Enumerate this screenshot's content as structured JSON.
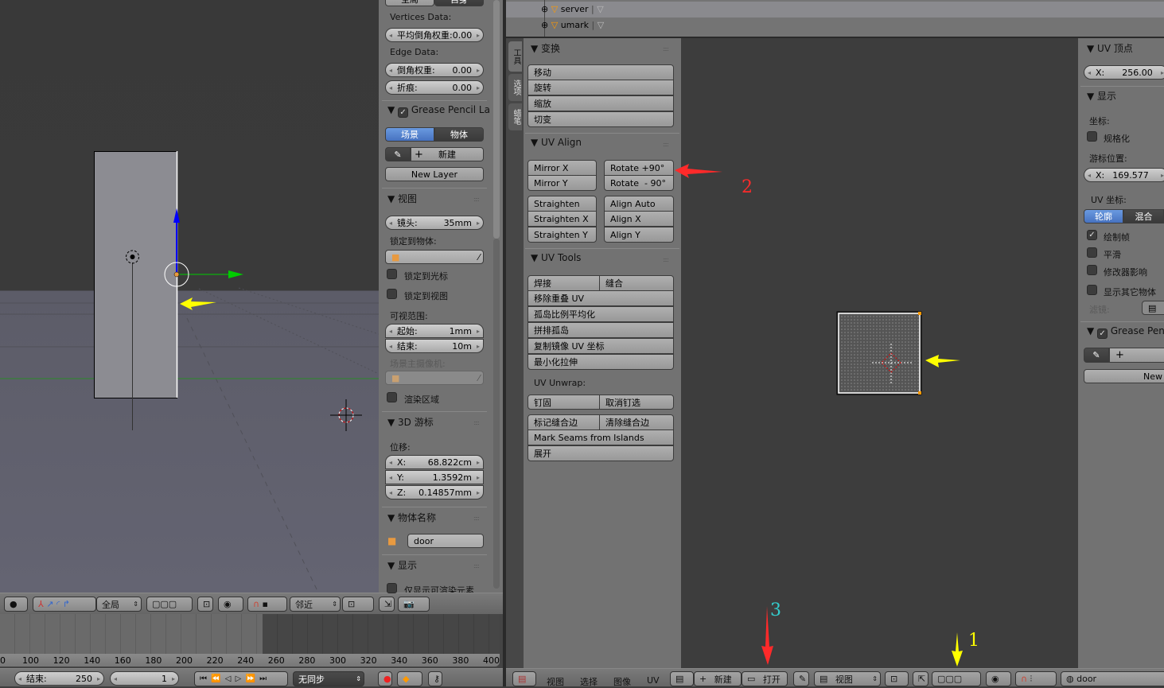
{
  "viewport3d": {
    "header": {
      "orientation_dropdown": "全局",
      "pivot_dropdown": "邻近"
    }
  },
  "properties": {
    "top_buttons": [
      "全局",
      "自身"
    ],
    "vertices_label": "Vertices Data:",
    "mean_bevel": "平均倒角权重:0.00",
    "edge_label": "Edge Data:",
    "bevel_weight": {
      "label": "倒角权重:",
      "value": "0.00"
    },
    "crease": {
      "label": "折痕:",
      "value": "0.00"
    },
    "grease_pencil": {
      "title": "Grease Pencil La",
      "checked": true,
      "tabs": [
        "场景",
        "物体"
      ],
      "new": "新建",
      "new_layer": "New Layer"
    },
    "view": {
      "title": "视图",
      "lens": {
        "label": "镜头:",
        "value": "35mm"
      },
      "lock_object": "锁定到物体:",
      "lock_cursor": "锁定到光标",
      "lock_view": "锁定到视图",
      "clip": "可视范围:",
      "clip_start": {
        "label": "起始:",
        "value": "1mm"
      },
      "clip_end": {
        "label": "结束:",
        "value": "10m"
      },
      "scene_camera": "场景主摄像机:",
      "render_border": "渲染区域"
    },
    "cursor3d": {
      "title": "3D 游标",
      "location": "位移:",
      "x": {
        "label": "X:",
        "value": "68.822cm"
      },
      "y": {
        "label": "Y:",
        "value": "1.3592m"
      },
      "z": {
        "label": "Z:",
        "value": "0.14857mm"
      }
    },
    "object_name": {
      "title": "物体名称",
      "value": "door"
    },
    "display": {
      "title": "显示",
      "only_render": "仅显示可渲染元素"
    }
  },
  "outliner": {
    "rows": [
      {
        "name": "server"
      },
      {
        "name": "umark"
      }
    ]
  },
  "uv_toolshelf": {
    "tabs": [
      "工具",
      "选项",
      "蜡笔"
    ],
    "transform": {
      "title": "变换",
      "buttons": [
        "移动",
        "旋转",
        "缩放",
        "切变"
      ]
    },
    "uv_align": {
      "title": "UV Align",
      "left": [
        "Mirror X",
        "Mirror Y"
      ],
      "right": [
        "Rotate +90°",
        "Rotate  - 90°"
      ],
      "left2": [
        "Straighten",
        "Straighten X",
        "Straighten Y"
      ],
      "right2": [
        "Align Auto",
        "Align X",
        "Align Y"
      ]
    },
    "uv_tools": {
      "title": "UV Tools",
      "weld": "焊接",
      "stitch": "缝合",
      "list": [
        "移除重叠 UV",
        "孤岛比例平均化",
        "拼排孤岛",
        "复制镜像 UV 坐标",
        "最小化拉伸"
      ],
      "unwrap_label": "UV Unwrap:",
      "pin": "钉固",
      "unpin": "取消钉选",
      "mark_seam": "标记缝合边",
      "clear_seam": "清除缝合边",
      "seams_islands": "Mark Seams from Islands",
      "unwrap": "展开"
    }
  },
  "npanel": {
    "uv_vertex": {
      "title": "UV 顶点",
      "x": {
        "label": "X:",
        "value": "256.00"
      }
    },
    "display": {
      "title": "显示",
      "coords": "坐标:",
      "normalized": "规格化",
      "cursor_loc": "游标位置:",
      "cursor_x": {
        "label": "X:",
        "value": "169.577"
      },
      "uv_coords": "UV 坐标:",
      "modes": [
        "轮廓",
        "混合"
      ],
      "draw_frames": "绘制帧",
      "smooth": "平滑",
      "modifier": "修改器影响",
      "other_objects": "显示其它物体",
      "filter": "滤镜:"
    },
    "grease_pencil": {
      "title": "Grease Pen",
      "new": "New"
    }
  },
  "timeline": {
    "ticks": [
      "0",
      "100",
      "120",
      "140",
      "160",
      "180",
      "200",
      "220",
      "240",
      "260",
      "280",
      "300",
      "320",
      "340",
      "360",
      "380",
      "400"
    ],
    "end": {
      "label": "结束:",
      "value": "250"
    },
    "current": "1",
    "sync": "无同步"
  },
  "uv_header": {
    "menus": [
      "视图",
      "选择",
      "图像",
      "UV"
    ],
    "new": "新建",
    "open": "打开",
    "view_dropdown": "视图",
    "object": "door"
  },
  "annotations": [
    "1",
    "2",
    "3"
  ],
  "colors": {
    "accent_blue": "#5680c2",
    "arrow_red": "#ff2a2a",
    "arrow_yellow": "#ffff00",
    "annotation_cyan": "#33cccc"
  }
}
